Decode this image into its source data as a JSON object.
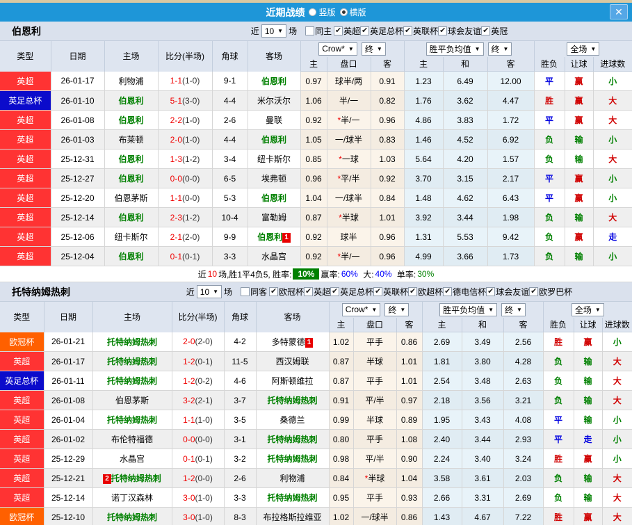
{
  "titlebar": {
    "title": "近期战绩",
    "vertical_label": "竖版",
    "horizontal_label": "横版",
    "selected_layout": "横版",
    "close_label": "✕"
  },
  "controls": {
    "near_label": "近",
    "near_value": "10",
    "matches_label": "场",
    "odds_source": "Crow*",
    "final_label": "终",
    "avg_label": "胜平负均值",
    "scope_label": "全场"
  },
  "columns": {
    "type": "类型",
    "date": "日期",
    "home": "主场",
    "score": "比分(半场)",
    "corner": "角球",
    "away": "客场",
    "h_home": "主",
    "h_line": "盘口",
    "h_away": "客",
    "a_home": "主",
    "a_draw": "和",
    "a_away": "客",
    "wdl": "胜负",
    "hres": "让球",
    "goals": "进球数"
  },
  "result_colors": {
    "red": "#d00000",
    "blue": "#0000e0",
    "green": "#008000"
  },
  "type_colors": {
    "red": "#ff3333",
    "blue": "#0b0bcb",
    "orange": "#ff6000"
  },
  "sections": [
    {
      "team": "伯恩利",
      "same_label": "同主",
      "same_checked": false,
      "competitions": [
        "英超",
        "英足总杯",
        "英联杯",
        "球会友谊",
        "英冠"
      ],
      "rows": [
        {
          "type": "英超",
          "tc": "red",
          "date": "26-01-17",
          "home": "利物浦",
          "hf": false,
          "hb": "",
          "score": "1-1",
          "half": "(1-0)",
          "corner": "9-1",
          "away": "伯恩利",
          "af": true,
          "ab": "",
          "o1": "0.97",
          "hc": "球半/两",
          "o2": "0.91",
          "a1": "1.23",
          "a2": "6.49",
          "a3": "12.00",
          "r1": "平",
          "r2": "赢",
          "r3": "小"
        },
        {
          "type": "英足总杯",
          "tc": "blue",
          "date": "26-01-10",
          "home": "伯恩利",
          "hf": true,
          "hb": "",
          "score": "5-1",
          "half": "(3-0)",
          "corner": "4-4",
          "away": "米尔沃尔",
          "af": false,
          "ab": "",
          "o1": "1.06",
          "hc": "半/一",
          "o2": "0.82",
          "a1": "1.76",
          "a2": "3.62",
          "a3": "4.47",
          "r1": "胜",
          "r2": "赢",
          "r3": "大"
        },
        {
          "type": "英超",
          "tc": "red",
          "date": "26-01-08",
          "home": "伯恩利",
          "hf": true,
          "hb": "",
          "score": "2-2",
          "half": "(1-0)",
          "corner": "2-6",
          "away": "曼联",
          "af": false,
          "ab": "",
          "o1": "0.92",
          "hc": "*半/一",
          "o2": "0.96",
          "a1": "4.86",
          "a2": "3.83",
          "a3": "1.72",
          "r1": "平",
          "r2": "赢",
          "r3": "大"
        },
        {
          "type": "英超",
          "tc": "red",
          "date": "26-01-03",
          "home": "布莱顿",
          "hf": false,
          "hb": "",
          "score": "2-0",
          "half": "(1-0)",
          "corner": "4-4",
          "away": "伯恩利",
          "af": true,
          "ab": "",
          "o1": "1.05",
          "hc": "一/球半",
          "o2": "0.83",
          "a1": "1.46",
          "a2": "4.52",
          "a3": "6.92",
          "r1": "负",
          "r2": "输",
          "r3": "小"
        },
        {
          "type": "英超",
          "tc": "red",
          "date": "25-12-31",
          "home": "伯恩利",
          "hf": true,
          "hb": "",
          "score": "1-3",
          "half": "(1-2)",
          "corner": "3-4",
          "away": "纽卡斯尔",
          "af": false,
          "ab": "",
          "o1": "0.85",
          "hc": "*一球",
          "o2": "1.03",
          "a1": "5.64",
          "a2": "4.20",
          "a3": "1.57",
          "r1": "负",
          "r2": "输",
          "r3": "大"
        },
        {
          "type": "英超",
          "tc": "red",
          "date": "25-12-27",
          "home": "伯恩利",
          "hf": true,
          "hb": "",
          "score": "0-0",
          "half": "(0-0)",
          "corner": "6-5",
          "away": "埃弗顿",
          "af": false,
          "ab": "",
          "o1": "0.96",
          "hc": "*平/半",
          "o2": "0.92",
          "a1": "3.70",
          "a2": "3.15",
          "a3": "2.17",
          "r1": "平",
          "r2": "赢",
          "r3": "小"
        },
        {
          "type": "英超",
          "tc": "red",
          "date": "25-12-20",
          "home": "伯恩茅斯",
          "hf": false,
          "hb": "",
          "score": "1-1",
          "half": "(0-0)",
          "corner": "5-3",
          "away": "伯恩利",
          "af": true,
          "ab": "",
          "o1": "1.04",
          "hc": "一/球半",
          "o2": "0.84",
          "a1": "1.48",
          "a2": "4.62",
          "a3": "6.43",
          "r1": "平",
          "r2": "赢",
          "r3": "小"
        },
        {
          "type": "英超",
          "tc": "red",
          "date": "25-12-14",
          "home": "伯恩利",
          "hf": true,
          "hb": "",
          "score": "2-3",
          "half": "(1-2)",
          "corner": "10-4",
          "away": "富勒姆",
          "af": false,
          "ab": "",
          "o1": "0.87",
          "hc": "*半球",
          "o2": "1.01",
          "a1": "3.92",
          "a2": "3.44",
          "a3": "1.98",
          "r1": "负",
          "r2": "输",
          "r3": "大"
        },
        {
          "type": "英超",
          "tc": "red",
          "date": "25-12-06",
          "home": "纽卡斯尔",
          "hf": false,
          "hb": "",
          "score": "2-1",
          "half": "(2-0)",
          "corner": "9-9",
          "away": "伯恩利",
          "af": true,
          "ab": "1",
          "o1": "0.92",
          "hc": "球半",
          "o2": "0.96",
          "a1": "1.31",
          "a2": "5.53",
          "a3": "9.42",
          "r1": "负",
          "r2": "赢",
          "r3": "走"
        },
        {
          "type": "英超",
          "tc": "red",
          "date": "25-12-04",
          "home": "伯恩利",
          "hf": true,
          "hb": "",
          "score": "0-1",
          "half": "(0-1)",
          "corner": "3-3",
          "away": "水晶宫",
          "af": false,
          "ab": "",
          "o1": "0.92",
          "hc": "*半/一",
          "o2": "0.96",
          "a1": "4.99",
          "a2": "3.66",
          "a3": "1.73",
          "r1": "负",
          "r2": "输",
          "r3": "小"
        }
      ],
      "summary": {
        "pre": "近",
        "count": "10",
        "mid": "场,胜1平4负5, 胜率:",
        "win_rate": "10%",
        "win_label": "赢率:",
        "win": "60%",
        "big_label": "大:",
        "big": "40%",
        "single_label": "单率:",
        "single": "30%"
      }
    },
    {
      "team": "托特纳姆热刺",
      "same_label": "同客",
      "same_checked": false,
      "competitions": [
        "欧冠杯",
        "英超",
        "英足总杯",
        "英联杯",
        "欧超杯",
        "德电信杯",
        "球会友谊",
        "欧罗巴杯"
      ],
      "rows": [
        {
          "type": "欧冠杯",
          "tc": "orange",
          "date": "26-01-21",
          "home": "托特纳姆热刺",
          "hf": true,
          "hb": "",
          "score": "2-0",
          "half": "(2-0)",
          "corner": "4-2",
          "away": "多特蒙德",
          "af": false,
          "ab": "1",
          "o1": "1.02",
          "hc": "平手",
          "o2": "0.86",
          "a1": "2.69",
          "a2": "3.49",
          "a3": "2.56",
          "r1": "胜",
          "r2": "赢",
          "r3": "小"
        },
        {
          "type": "英超",
          "tc": "red",
          "date": "26-01-17",
          "home": "托特纳姆热刺",
          "hf": true,
          "hb": "",
          "score": "1-2",
          "half": "(0-1)",
          "corner": "11-5",
          "away": "西汉姆联",
          "af": false,
          "ab": "",
          "o1": "0.87",
          "hc": "半球",
          "o2": "1.01",
          "a1": "1.81",
          "a2": "3.80",
          "a3": "4.28",
          "r1": "负",
          "r2": "输",
          "r3": "大"
        },
        {
          "type": "英足总杯",
          "tc": "blue",
          "date": "26-01-11",
          "home": "托特纳姆热刺",
          "hf": true,
          "hb": "",
          "score": "1-2",
          "half": "(0-2)",
          "corner": "4-6",
          "away": "阿斯顿维拉",
          "af": false,
          "ab": "",
          "o1": "0.87",
          "hc": "平手",
          "o2": "1.01",
          "a1": "2.54",
          "a2": "3.48",
          "a3": "2.63",
          "r1": "负",
          "r2": "输",
          "r3": "大"
        },
        {
          "type": "英超",
          "tc": "red",
          "date": "26-01-08",
          "home": "伯恩茅斯",
          "hf": false,
          "hb": "",
          "score": "3-2",
          "half": "(2-1)",
          "corner": "3-7",
          "away": "托特纳姆热刺",
          "af": true,
          "ab": "",
          "o1": "0.91",
          "hc": "平/半",
          "o2": "0.97",
          "a1": "2.18",
          "a2": "3.56",
          "a3": "3.21",
          "r1": "负",
          "r2": "输",
          "r3": "大"
        },
        {
          "type": "英超",
          "tc": "red",
          "date": "26-01-04",
          "home": "托特纳姆热刺",
          "hf": true,
          "hb": "",
          "score": "1-1",
          "half": "(1-0)",
          "corner": "3-5",
          "away": "桑德兰",
          "af": false,
          "ab": "",
          "o1": "0.99",
          "hc": "半球",
          "o2": "0.89",
          "a1": "1.95",
          "a2": "3.43",
          "a3": "4.08",
          "r1": "平",
          "r2": "输",
          "r3": "小"
        },
        {
          "type": "英超",
          "tc": "red",
          "date": "26-01-02",
          "home": "布伦特福德",
          "hf": false,
          "hb": "",
          "score": "0-0",
          "half": "(0-0)",
          "corner": "3-1",
          "away": "托特纳姆热刺",
          "af": true,
          "ab": "",
          "o1": "0.80",
          "hc": "平手",
          "o2": "1.08",
          "a1": "2.40",
          "a2": "3.44",
          "a3": "2.93",
          "r1": "平",
          "r2": "走",
          "r3": "小"
        },
        {
          "type": "英超",
          "tc": "red",
          "date": "25-12-29",
          "home": "水晶宫",
          "hf": false,
          "hb": "",
          "score": "0-1",
          "half": "(0-1)",
          "corner": "3-2",
          "away": "托特纳姆热刺",
          "af": true,
          "ab": "",
          "o1": "0.98",
          "hc": "平/半",
          "o2": "0.90",
          "a1": "2.24",
          "a2": "3.40",
          "a3": "3.24",
          "r1": "胜",
          "r2": "赢",
          "r3": "小"
        },
        {
          "type": "英超",
          "tc": "red",
          "date": "25-12-21",
          "home": "托特纳姆热刺",
          "hf": true,
          "hb": "2",
          "score": "1-2",
          "half": "(0-0)",
          "corner": "2-6",
          "away": "利物浦",
          "af": false,
          "ab": "",
          "o1": "0.84",
          "hc": "*半球",
          "o2": "1.04",
          "a1": "3.58",
          "a2": "3.61",
          "a3": "2.03",
          "r1": "负",
          "r2": "输",
          "r3": "大"
        },
        {
          "type": "英超",
          "tc": "red",
          "date": "25-12-14",
          "home": "诺丁汉森林",
          "hf": false,
          "hb": "",
          "score": "3-0",
          "half": "(1-0)",
          "corner": "3-3",
          "away": "托特纳姆热刺",
          "af": true,
          "ab": "",
          "o1": "0.95",
          "hc": "平手",
          "o2": "0.93",
          "a1": "2.66",
          "a2": "3.31",
          "a3": "2.69",
          "r1": "负",
          "r2": "输",
          "r3": "大"
        },
        {
          "type": "欧冠杯",
          "tc": "orange",
          "date": "25-12-10",
          "home": "托特纳姆热刺",
          "hf": true,
          "hb": "",
          "score": "3-0",
          "half": "(1-0)",
          "corner": "8-3",
          "away": "布拉格斯拉维亚",
          "af": false,
          "ab": "",
          "o1": "1.02",
          "hc": "一/球半",
          "o2": "0.86",
          "a1": "1.43",
          "a2": "4.67",
          "a3": "7.22",
          "r1": "胜",
          "r2": "赢",
          "r3": "大"
        }
      ],
      "summary": null
    }
  ]
}
